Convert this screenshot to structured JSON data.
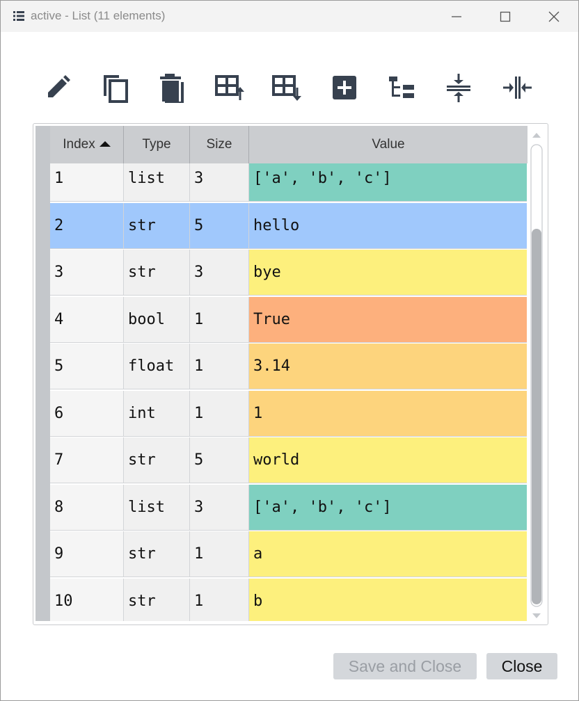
{
  "window": {
    "title": "active - List (11 elements)",
    "controls": [
      "minimize-icon",
      "maximize-icon",
      "close-icon"
    ]
  },
  "toolbar": {
    "icons": [
      "edit-icon",
      "copy-icon",
      "duplicate-icon",
      "insert-row-above-icon",
      "insert-row-below-icon",
      "add-icon",
      "tree-view-icon",
      "collapse-vertical-icon",
      "collapse-horizontal-icon"
    ]
  },
  "table": {
    "columns": [
      {
        "label": "Index",
        "sorted": "ascending"
      },
      {
        "label": "Type"
      },
      {
        "label": "Size"
      },
      {
        "label": "Value"
      }
    ],
    "rows": [
      {
        "index": "1",
        "type": "list",
        "size": "3",
        "value": "['a', 'b', 'c']",
        "color": "#7fd0c0"
      },
      {
        "index": "2",
        "type": "str",
        "size": "5",
        "value": "hello",
        "color": "#a0c8fc",
        "selected": true
      },
      {
        "index": "3",
        "type": "str",
        "size": "3",
        "value": "bye",
        "color": "#fdf07d"
      },
      {
        "index": "4",
        "type": "bool",
        "size": "1",
        "value": "True",
        "color": "#fdb07d"
      },
      {
        "index": "5",
        "type": "float",
        "size": "1",
        "value": "3.14",
        "color": "#fdd47d"
      },
      {
        "index": "6",
        "type": "int",
        "size": "1",
        "value": "1",
        "color": "#fdd47d"
      },
      {
        "index": "7",
        "type": "str",
        "size": "5",
        "value": "world",
        "color": "#fdf07d"
      },
      {
        "index": "8",
        "type": "list",
        "size": "3",
        "value": "['a', 'b', 'c']",
        "color": "#7fd0c0"
      },
      {
        "index": "9",
        "type": "str",
        "size": "1",
        "value": "a",
        "color": "#fdf07d"
      },
      {
        "index": "10",
        "type": "str",
        "size": "1",
        "value": "b",
        "color": "#fdf07d"
      }
    ]
  },
  "buttons": {
    "save_close": "Save and Close",
    "close": "Close"
  },
  "colors": {
    "selected_row": "#a0c8fc",
    "index_cell": "#f5f5f5",
    "typesize_cell": "#f0f0f0",
    "button_bg": "#d4d7db"
  }
}
